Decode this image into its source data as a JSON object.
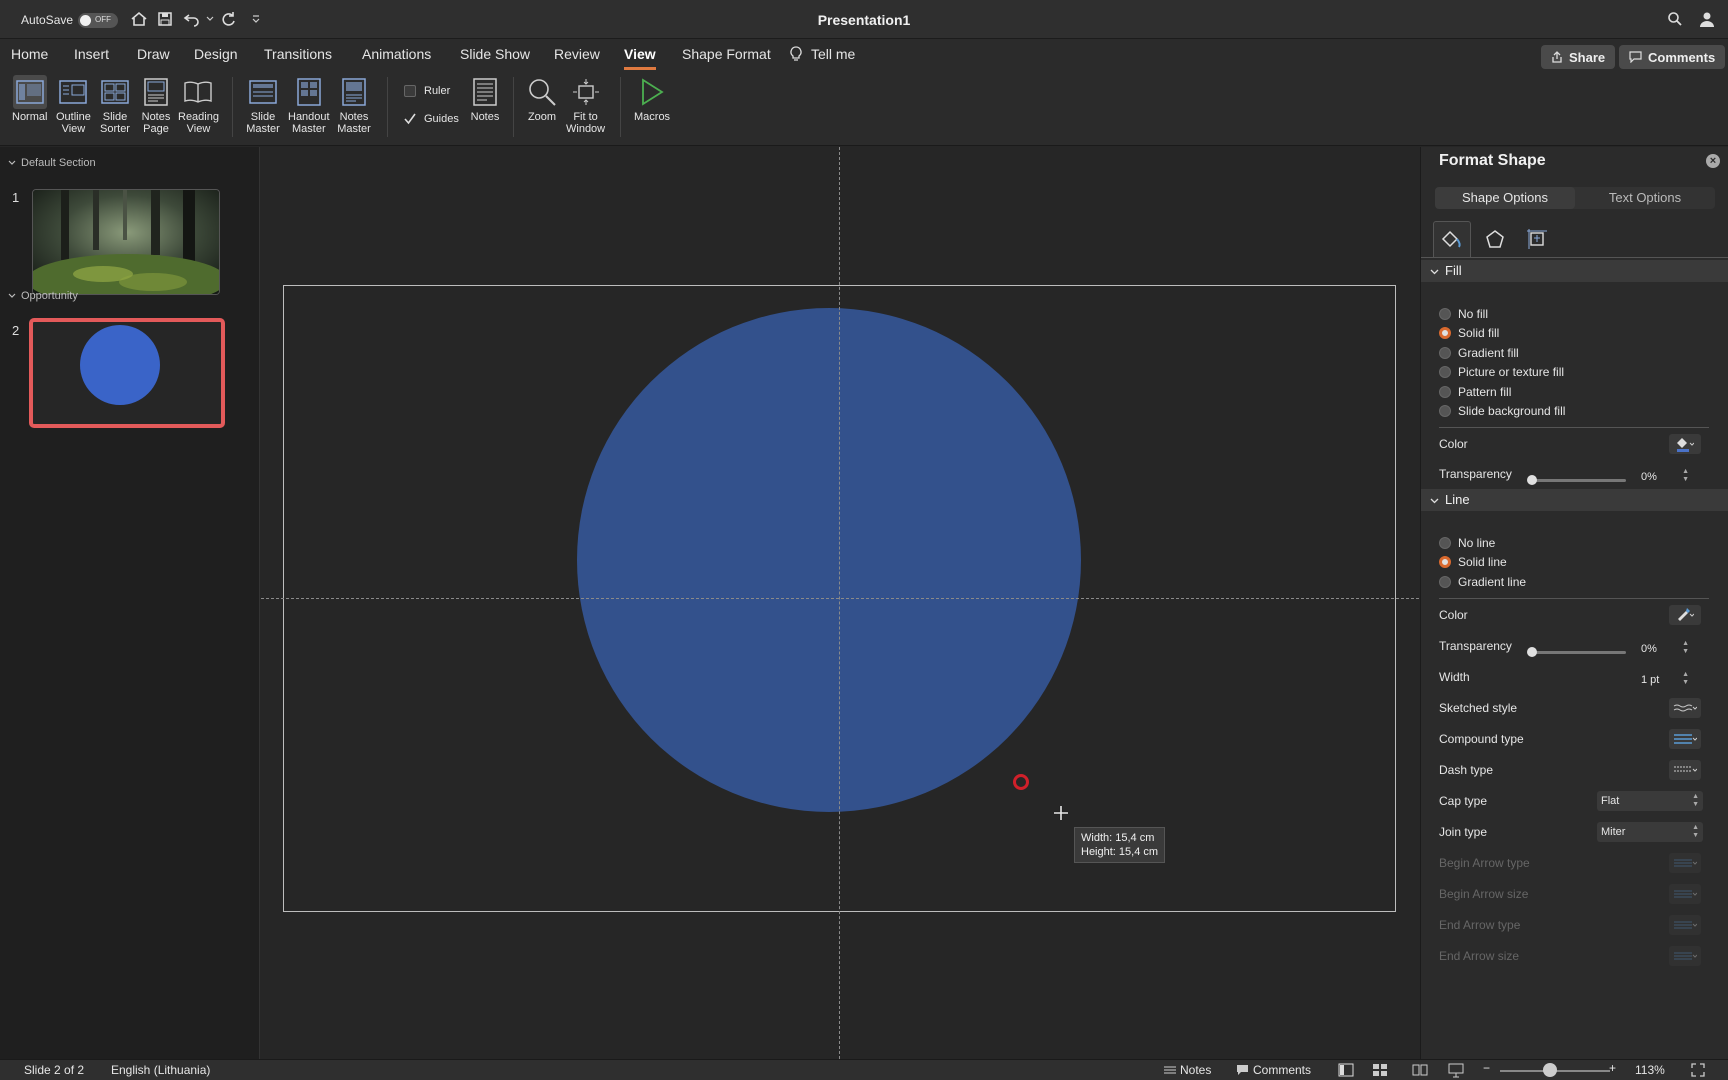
{
  "titlebar": {
    "autosave_label": "AutoSave",
    "autosave_state": "OFF",
    "document_title": "Presentation1"
  },
  "tabs": [
    "Home",
    "Insert",
    "Draw",
    "Design",
    "Transitions",
    "Animations",
    "Slide Show",
    "Review",
    "View",
    "Shape Format"
  ],
  "active_tab": "View",
  "tell_me": "Tell me",
  "share_label": "Share",
  "comments_label": "Comments",
  "ribbon": {
    "normal": "Normal",
    "outline_view": [
      "Outline",
      "View"
    ],
    "slide_sorter": [
      "Slide",
      "Sorter"
    ],
    "notes_page": [
      "Notes",
      "Page"
    ],
    "reading_view": [
      "Reading",
      "View"
    ],
    "slide_master": [
      "Slide",
      "Master"
    ],
    "handout_master": [
      "Handout",
      "Master"
    ],
    "notes_master": [
      "Notes",
      "Master"
    ],
    "ruler": "Ruler",
    "guides": "Guides",
    "notes": "Notes",
    "zoom": "Zoom",
    "fit_to_window": [
      "Fit to",
      "Window"
    ],
    "macros": "Macros"
  },
  "thumbnails": {
    "section1": "Default Section",
    "section2": "Opportunity",
    "slide1_num": "1",
    "slide2_num": "2"
  },
  "canvas": {
    "size_tip_width": "Width: 15,4 cm",
    "size_tip_height": "Height: 15,4 cm",
    "shape_fill": "#33518c"
  },
  "panel": {
    "title": "Format Shape",
    "tab_shape": "Shape Options",
    "tab_text": "Text Options",
    "fill_header": "Fill",
    "fill_options": [
      "No fill",
      "Solid fill",
      "Gradient fill",
      "Picture or texture fill",
      "Pattern fill",
      "Slide background fill"
    ],
    "fill_selected": "Solid fill",
    "color_label": "Color",
    "transparency_label": "Transparency",
    "fill_transparency": "0%",
    "line_header": "Line",
    "line_options": [
      "No line",
      "Solid line",
      "Gradient line"
    ],
    "line_selected": "Solid line",
    "line_color_label": "Color",
    "line_transparency_label": "Transparency",
    "line_transparency": "0%",
    "width_label": "Width",
    "width_value": "1 pt",
    "sketched_label": "Sketched style",
    "compound_label": "Compound type",
    "dash_label": "Dash type",
    "cap_label": "Cap type",
    "cap_value": "Flat",
    "join_label": "Join type",
    "join_value": "Miter",
    "begin_arrow_type": "Begin Arrow type",
    "begin_arrow_size": "Begin Arrow size",
    "end_arrow_type": "End Arrow type",
    "end_arrow_size": "End Arrow size"
  },
  "status": {
    "slide_info": "Slide 2 of 2",
    "language": "English (Lithuania)",
    "notes": "Notes",
    "comments": "Comments",
    "zoom": "113%"
  }
}
